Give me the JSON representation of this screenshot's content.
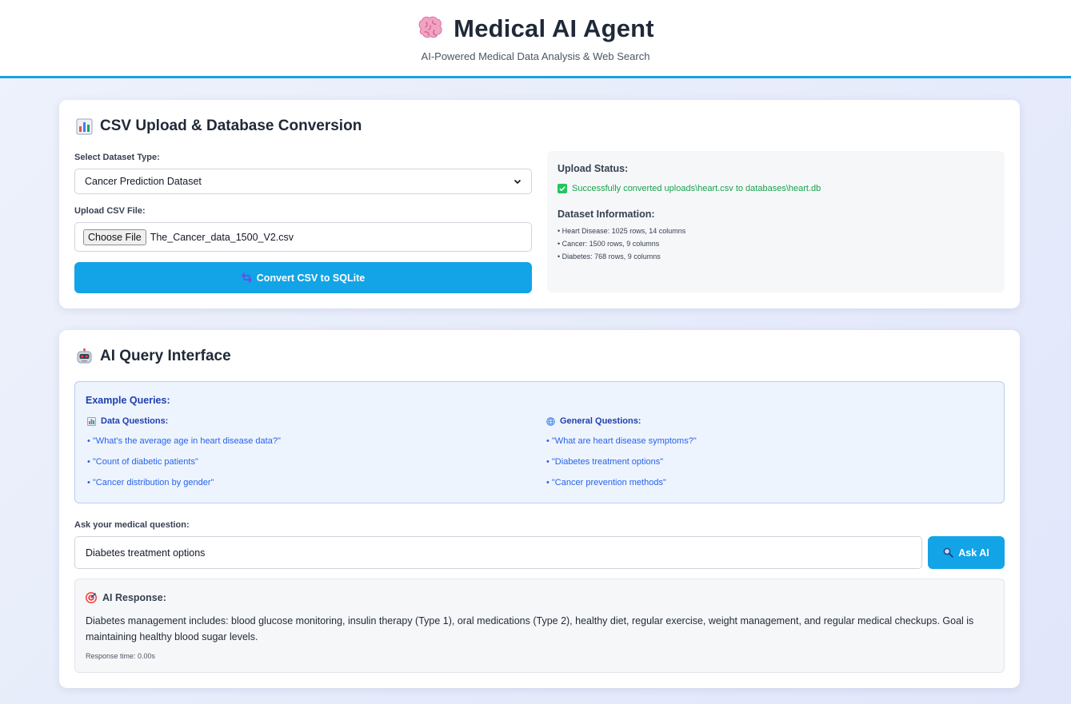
{
  "header": {
    "title": "Medical AI Agent",
    "subtitle": "AI-Powered Medical Data Analysis & Web Search",
    "icon": "brain-icon"
  },
  "upload": {
    "title": "CSV Upload & Database Conversion",
    "icon": "bar-chart-icon",
    "select_label": "Select Dataset Type:",
    "select_value": "Cancer Prediction Dataset",
    "file_label": "Upload CSV File:",
    "file_button": "Choose File",
    "file_name": "The_Cancer_data_1500_V2.csv",
    "convert_button": "Convert CSV to SQLite",
    "convert_icon": "swap-arrows-icon",
    "status_title": "Upload Status:",
    "status_message": "Successfully converted uploads\\heart.csv to databases\\heart.db",
    "dataset_title": "Dataset Information:",
    "datasets": [
      "• Heart Disease: 1025 rows, 14 columns",
      "• Cancer: 1500 rows, 9 columns",
      "• Diabetes: 768 rows, 9 columns"
    ]
  },
  "query": {
    "title": "AI Query Interface",
    "icon": "robot-icon",
    "examples_title": "Example Queries:",
    "data_heading": "Data Questions:",
    "data_questions": [
      "• \"What's the average age in heart disease data?\"",
      "• \"Count of diabetic patients\"",
      "• \"Cancer distribution by gender\""
    ],
    "general_heading": "General Questions:",
    "general_questions": [
      "• \"What are heart disease symptoms?\"",
      "• \"Diabetes treatment options\"",
      "• \"Cancer prevention methods\""
    ],
    "question_label": "Ask your medical question:",
    "question_value": "Diabetes treatment options",
    "ask_button": "Ask AI",
    "response_title": "AI Response:",
    "response_text": "Diabetes management includes: blood glucose monitoring, insulin therapy (Type 1), oral medications (Type 2), healthy diet, regular exercise, weight management, and regular medical checkups. Goal is maintaining healthy blood sugar levels.",
    "response_time": "Response time: 0.00s"
  },
  "colors": {
    "accent": "#12a4e6",
    "success": "#16a34a",
    "example_text": "#2563eb"
  }
}
